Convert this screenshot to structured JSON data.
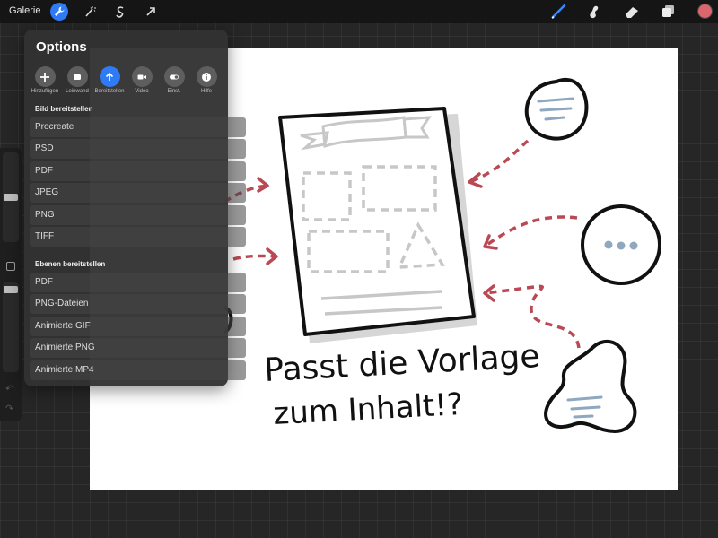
{
  "toolbar": {
    "gallery_label": "Galerie",
    "active_tool": "wrench-icon",
    "left_icons": [
      "wrench-icon",
      "magic-wand-icon",
      "selection-s-icon",
      "transform-arrow-icon"
    ],
    "right_icons": [
      "brush-icon",
      "smudge-icon",
      "eraser-icon",
      "layers-icon"
    ],
    "current_color": "#d9676d"
  },
  "panel": {
    "title": "Options",
    "tabs": [
      {
        "label": "Hinzufügen",
        "icon": "plus-icon",
        "active": false
      },
      {
        "label": "Leinwand",
        "icon": "canvas-icon",
        "active": false
      },
      {
        "label": "Bereitstellen",
        "icon": "share-arrow-icon",
        "active": true
      },
      {
        "label": "Video",
        "icon": "video-icon",
        "active": false
      },
      {
        "label": "Einst.",
        "icon": "toggle-icon",
        "active": false
      },
      {
        "label": "Hilfe",
        "icon": "info-icon",
        "active": false
      }
    ],
    "section_image": {
      "heading": "Bild bereitstellen",
      "items": [
        "Procreate",
        "PSD",
        "PDF",
        "JPEG",
        "PNG",
        "TIFF"
      ]
    },
    "section_layers": {
      "heading": "Ebenen bereitstellen",
      "items": [
        "PDF",
        "PNG-Dateien",
        "Animierte GIF",
        "Animierte PNG",
        "Animierte MP4"
      ]
    }
  },
  "canvas": {
    "caption_line1": "Passt die Vorlage",
    "caption_line2": "zum Inhalt!?"
  },
  "colors": {
    "accent": "#2f7bf6",
    "arrow": "#b94a55",
    "bubble_lines": "#8fa8bf"
  }
}
